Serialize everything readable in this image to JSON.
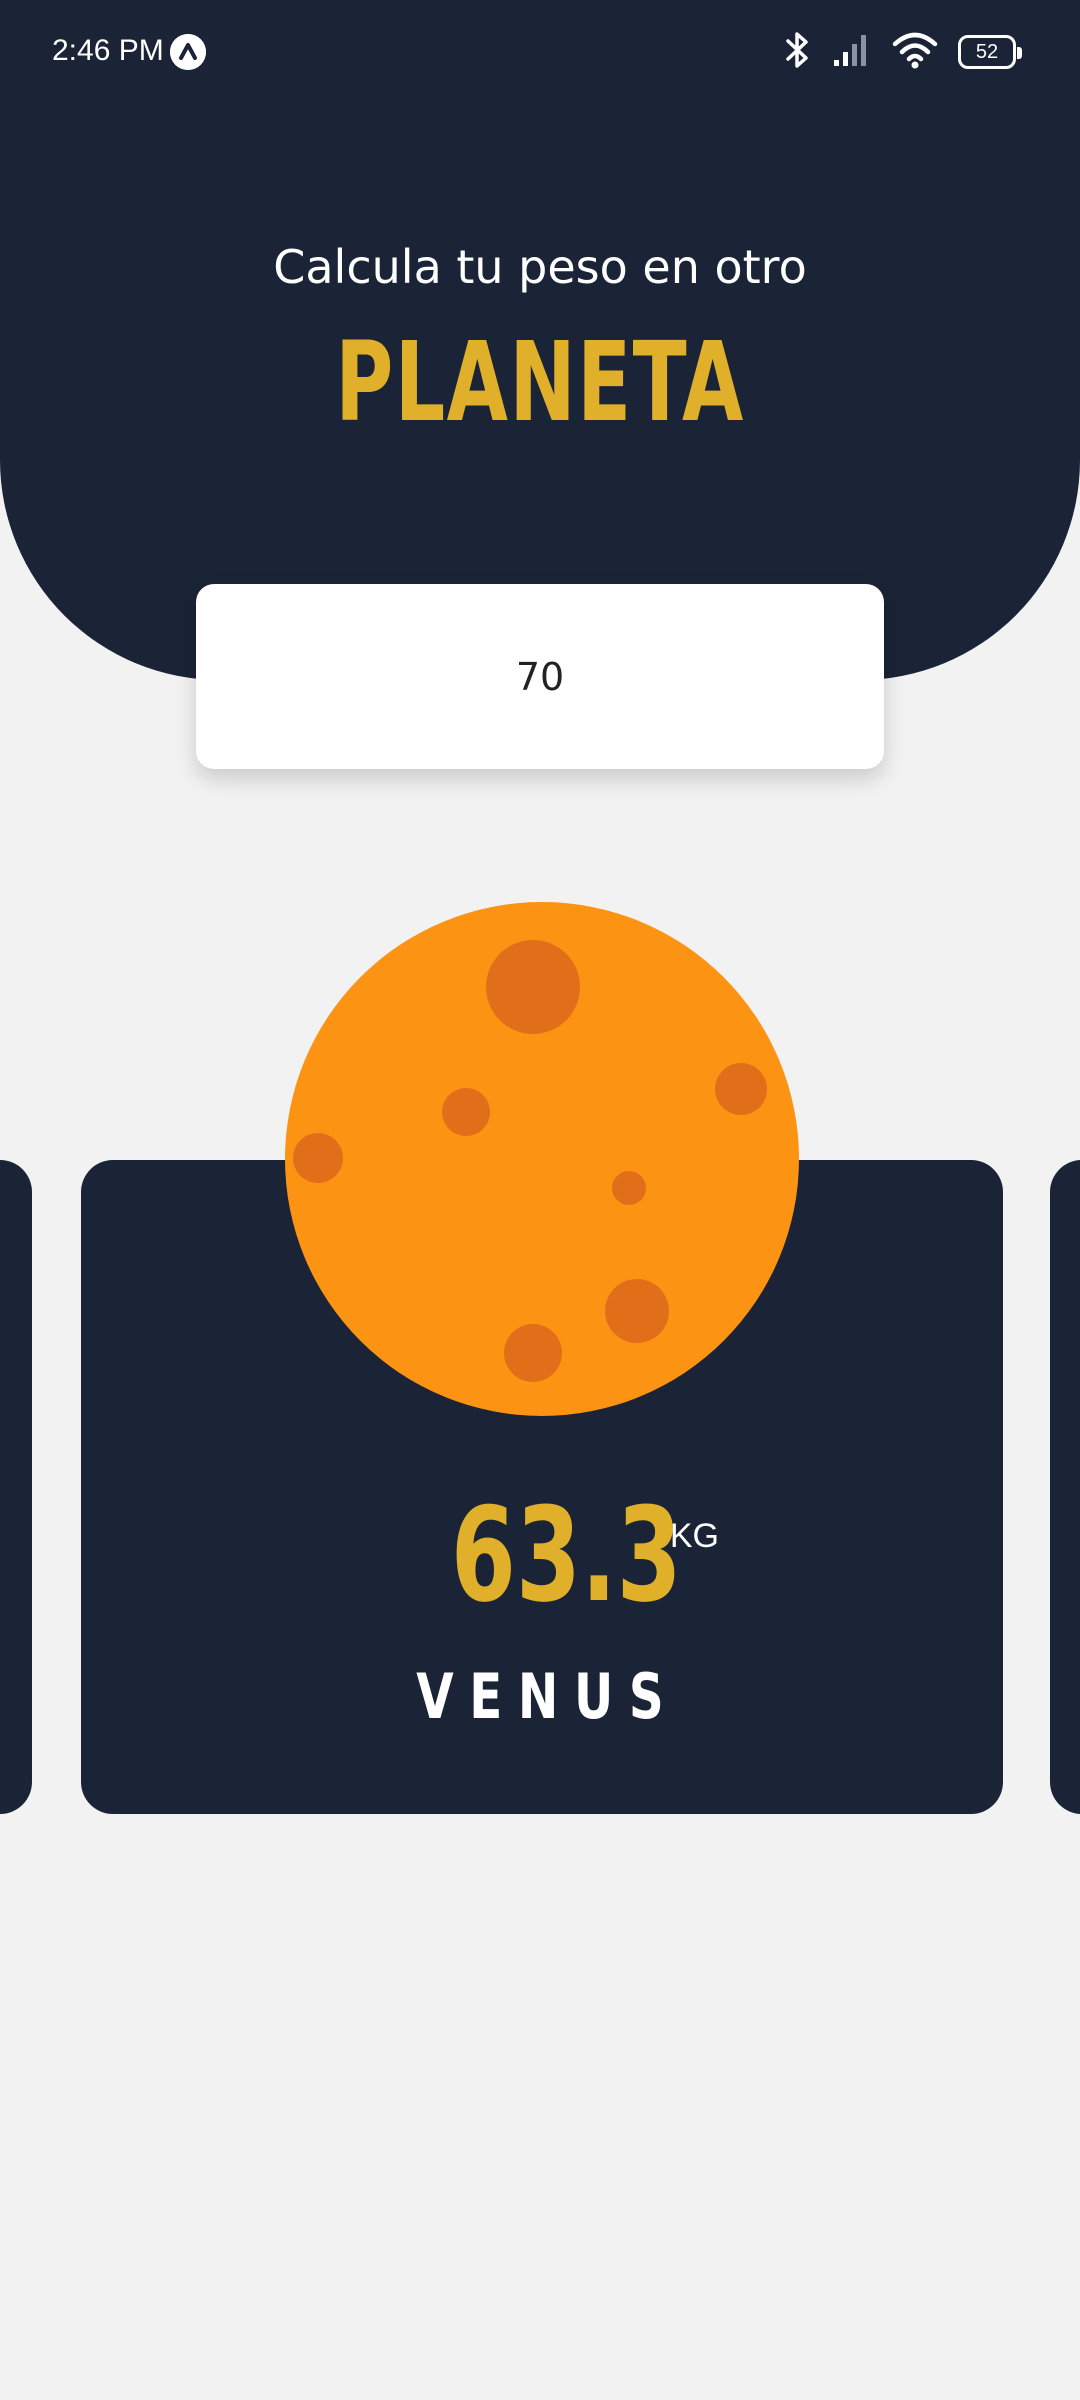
{
  "status_bar": {
    "time": "2:46 PM",
    "battery": "52",
    "icons": [
      "app-notification-icon",
      "bluetooth-icon",
      "signal-icon",
      "wifi-icon",
      "battery-icon"
    ]
  },
  "header": {
    "subtitle": "Calcula tu peso en otro",
    "title": "PLANETA"
  },
  "input": {
    "value": "70"
  },
  "card": {
    "planet_icon": "venus-planet-illustration",
    "weight": "63.3",
    "unit": "KG",
    "planet_name": "VENUS"
  },
  "colors": {
    "dark": "#1a2436",
    "accent": "#e0b02a",
    "background": "#f2f2f2",
    "planet": "#fd9313",
    "crater": "#e16f19"
  }
}
